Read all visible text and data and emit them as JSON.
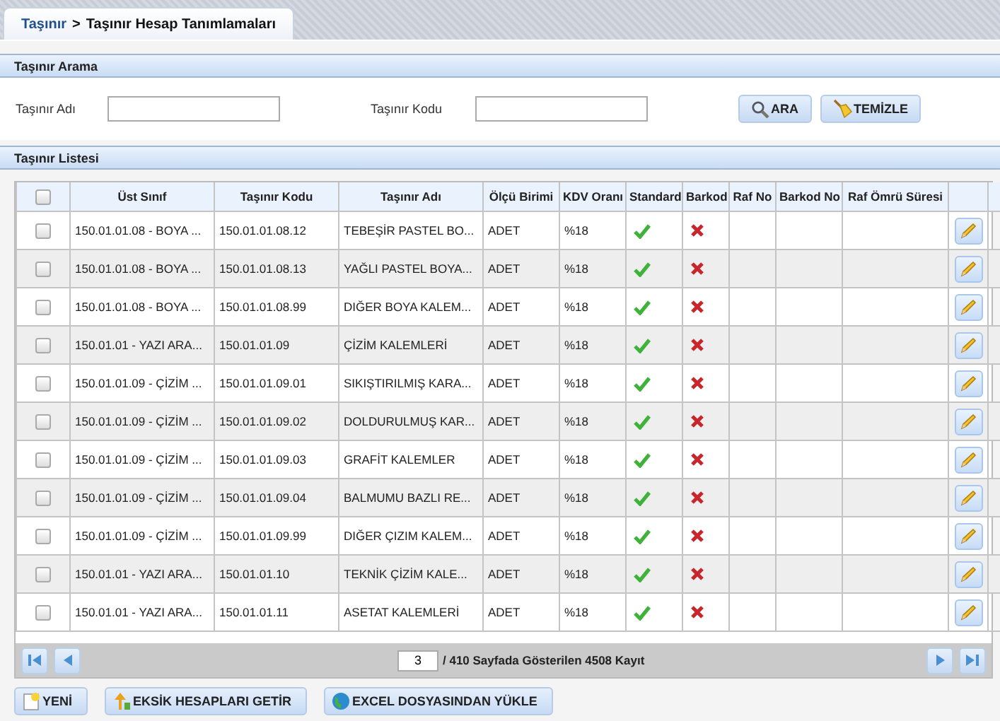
{
  "breadcrumb": {
    "parent": "Taşınır",
    "separator": ">",
    "current": "Taşınır Hesap Tanımlamaları"
  },
  "search_panel": {
    "title": "Taşınır Arama",
    "fields": [
      {
        "label": "Taşınır Adı"
      },
      {
        "label": "Taşınır Kodu"
      }
    ],
    "buttons": [
      {
        "label": "ARA",
        "kind": "search"
      },
      {
        "label": "TEMİZLE",
        "kind": "clear"
      }
    ]
  },
  "list_panel": {
    "title": "Taşınır Listesi"
  },
  "table": {
    "select_all": false,
    "columns": [
      "Üst Sınıf",
      "Taşınır Kodu",
      "Taşınır Adı",
      "Ölçü Birimi",
      "KDV Oranı",
      "Standard",
      "Barkod",
      "Raf No",
      "Barkod No",
      "Raf Ömrü Süresi"
    ],
    "rows": [
      {
        "checked": false,
        "ust_sinif": "150.01.01.08 - BOYA ...",
        "kod": "150.01.01.08.12",
        "ad": "TEBEŞİR PASTEL BO...",
        "birim": "ADET",
        "kdv": "%18",
        "standard": true,
        "barkod": false
      },
      {
        "checked": false,
        "ust_sinif": "150.01.01.08 - BOYA ...",
        "kod": "150.01.01.08.13",
        "ad": "YAĞLI PASTEL BOYA...",
        "birim": "ADET",
        "kdv": "%18",
        "standard": true,
        "barkod": false
      },
      {
        "checked": false,
        "ust_sinif": "150.01.01.08 - BOYA ...",
        "kod": "150.01.01.08.99",
        "ad": "DIĞER BOYA KALEM...",
        "birim": "ADET",
        "kdv": "%18",
        "standard": true,
        "barkod": false
      },
      {
        "checked": false,
        "ust_sinif": "150.01.01 - YAZI ARA...",
        "kod": "150.01.01.09",
        "ad": "ÇİZİM KALEMLERİ",
        "birim": "ADET",
        "kdv": "%18",
        "standard": true,
        "barkod": false
      },
      {
        "checked": false,
        "ust_sinif": "150.01.01.09 - ÇİZİM ...",
        "kod": "150.01.01.09.01",
        "ad": "SIKIŞTIRILMIŞ KARA...",
        "birim": "ADET",
        "kdv": "%18",
        "standard": true,
        "barkod": false
      },
      {
        "checked": false,
        "ust_sinif": "150.01.01.09 - ÇİZİM ...",
        "kod": "150.01.01.09.02",
        "ad": "DOLDURULMUŞ KAR...",
        "birim": "ADET",
        "kdv": "%18",
        "standard": true,
        "barkod": false
      },
      {
        "checked": false,
        "ust_sinif": "150.01.01.09 - ÇİZİM ...",
        "kod": "150.01.01.09.03",
        "ad": "GRAFİT KALEMLER",
        "birim": "ADET",
        "kdv": "%18",
        "standard": true,
        "barkod": false
      },
      {
        "checked": false,
        "ust_sinif": "150.01.01.09 - ÇİZİM ...",
        "kod": "150.01.01.09.04",
        "ad": "BALMUMU BAZLI RE...",
        "birim": "ADET",
        "kdv": "%18",
        "standard": true,
        "barkod": false
      },
      {
        "checked": false,
        "ust_sinif": "150.01.01.09 - ÇİZİM ...",
        "kod": "150.01.01.09.99",
        "ad": "DIĞER ÇIZIM KALEM...",
        "birim": "ADET",
        "kdv": "%18",
        "standard": true,
        "barkod": false
      },
      {
        "checked": false,
        "ust_sinif": "150.01.01 - YAZI ARA...",
        "kod": "150.01.01.10",
        "ad": "TEKNİK ÇİZİM KALE...",
        "birim": "ADET",
        "kdv": "%18",
        "standard": true,
        "barkod": false
      },
      {
        "checked": false,
        "ust_sinif": "150.01.01 - YAZI ARA...",
        "kod": "150.01.01.11",
        "ad": "ASETAT KALEMLERİ",
        "birim": "ADET",
        "kdv": "%18",
        "standard": true,
        "barkod": false
      }
    ]
  },
  "pager": {
    "page": "3",
    "summary": "/ 410 Sayfada Gösterilen 4508 Kayıt"
  },
  "actions": [
    {
      "label": "YENİ",
      "kind": "new"
    },
    {
      "label": "EKSİK HESAPLARI GETİR",
      "kind": "fetch"
    },
    {
      "label": "EXCEL DOSYASINDAN YÜKLE",
      "kind": "excel"
    }
  ]
}
